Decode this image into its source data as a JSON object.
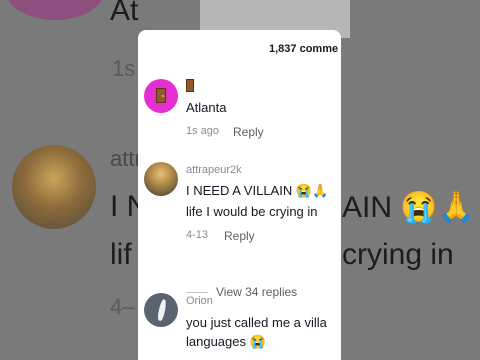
{
  "background": {
    "top_letters": "At",
    "timestamp_top": "1s",
    "username": "attr",
    "comment_line1": "I N",
    "comment_line1_right": "AIN 😭🙏",
    "comment_line2": "lif",
    "comment_line2_right": "crying in",
    "date": "4–"
  },
  "panel": {
    "comment_count": "1,837 comme",
    "comments": [
      {
        "username_icon": "door-icon",
        "text": "Atlanta",
        "time": "1s ago",
        "reply_label": "Reply"
      },
      {
        "username": "attrapeur2k",
        "text_line1": "I NEED A VILLAIN 😭🙏",
        "text_line2": "life I would be crying in",
        "time": "4-13",
        "reply_label": "Reply",
        "view_replies": "View 34 replies"
      },
      {
        "username": "Orion",
        "text_line1": "you just called me a villa",
        "text_line2": "languages 😭"
      }
    ]
  }
}
